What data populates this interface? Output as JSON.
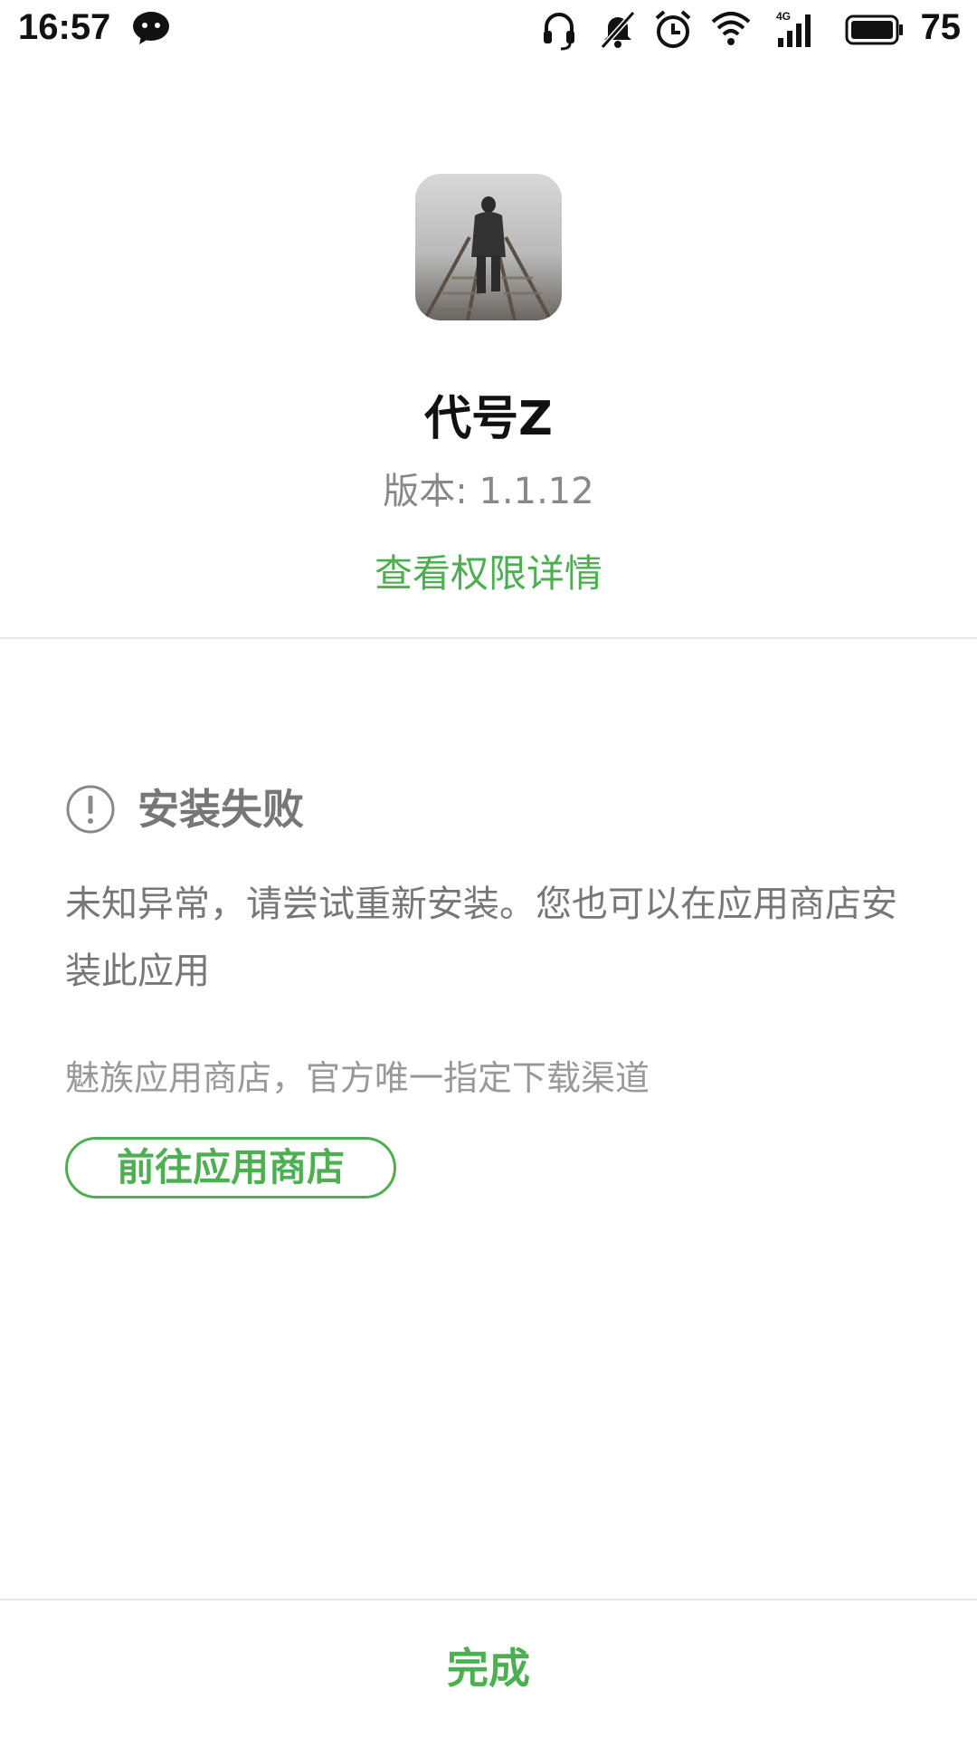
{
  "status_bar": {
    "time": "16:57",
    "battery": "75",
    "icons": [
      "wechat-icon",
      "headset-icon",
      "mute-icon",
      "alarm-icon",
      "wifi-icon",
      "signal-4g-icon",
      "battery-icon"
    ]
  },
  "app": {
    "name": "代号Z",
    "version": "版本: 1.1.12",
    "permissions_link": "查看权限详情"
  },
  "install": {
    "title": "安装失败",
    "message": "未知异常，请尝试重新安装。您也可以在应用商店安装此应用",
    "store_note": "魅族应用商店，官方唯一指定下载渠道",
    "store_button": "前往应用商店"
  },
  "footer": {
    "done_label": "完成"
  },
  "colors": {
    "accent": "#4caf50",
    "muted_text": "#777777",
    "divider": "#e6e6e6"
  }
}
